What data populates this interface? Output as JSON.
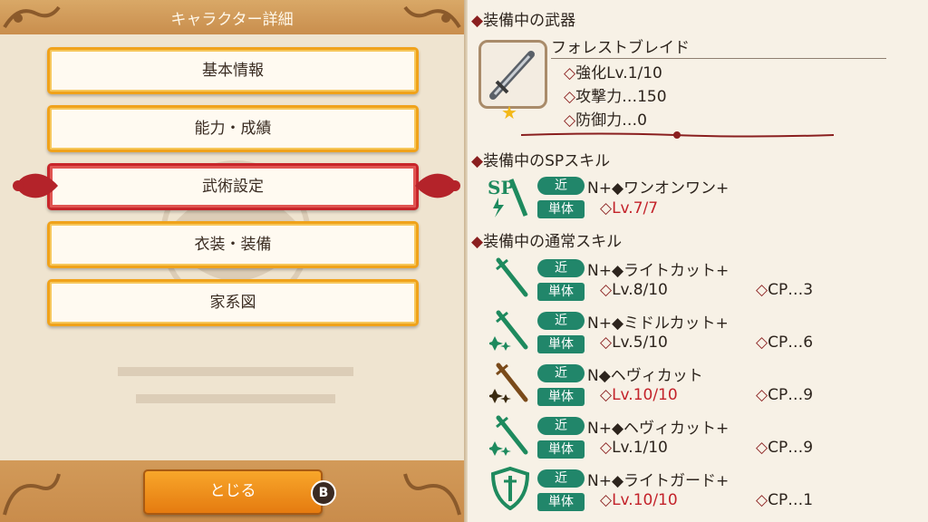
{
  "header": {
    "title": "キャラクター詳細"
  },
  "menu": [
    {
      "label": "基本情報",
      "selected": false
    },
    {
      "label": "能力・成績",
      "selected": false
    },
    {
      "label": "武術設定",
      "selected": true
    },
    {
      "label": "衣装・装備",
      "selected": false
    },
    {
      "label": "家系図",
      "selected": false
    }
  ],
  "footer": {
    "close_label": "とじる",
    "close_button_hint": "B"
  },
  "weapon": {
    "heading": "装備中の武器",
    "name": "フォレストブレイド",
    "rarity_icon": "star",
    "stats": [
      "強化Lv.1/10",
      "攻撃力…150",
      "防御力…0"
    ]
  },
  "sp_skill": {
    "heading": "装備中のSPスキル",
    "icon": "sp-lightning-sword",
    "range": "近",
    "target": "単体",
    "name": "N+◆ワンオンワン+",
    "level": "Lv.7/7",
    "level_maxed": true
  },
  "normal_skills": {
    "heading": "装備中の通常スキル",
    "items": [
      {
        "icon": "sword-green",
        "range": "近",
        "target": "単体",
        "name": "N+◆ライトカット+",
        "level": "Lv.8/10",
        "level_maxed": false,
        "cp": "CP…3"
      },
      {
        "icon": "sword-green-sparkle",
        "range": "近",
        "target": "単体",
        "name": "N+◆ミドルカット+",
        "level": "Lv.5/10",
        "level_maxed": false,
        "cp": "CP…6"
      },
      {
        "icon": "sword-brown-sparkle",
        "range": "近",
        "target": "単体",
        "name": "N◆ヘヴィカット",
        "level": "Lv.10/10",
        "level_maxed": true,
        "cp": "CP…9"
      },
      {
        "icon": "sword-green-sparkle",
        "range": "近",
        "target": "単体",
        "name": "N+◆ヘヴィカット+",
        "level": "Lv.1/10",
        "level_maxed": false,
        "cp": "CP…9"
      },
      {
        "icon": "shield-sword",
        "range": "近",
        "target": "単体",
        "name": "N+◆ライトガード+",
        "level": "Lv.10/10",
        "level_maxed": true,
        "cp": "CP…1"
      }
    ]
  },
  "colors": {
    "accent_orange": "#f0a21a",
    "selected_red": "#c8252a",
    "tag_green": "#21866a",
    "level_red": "#c3222a"
  }
}
